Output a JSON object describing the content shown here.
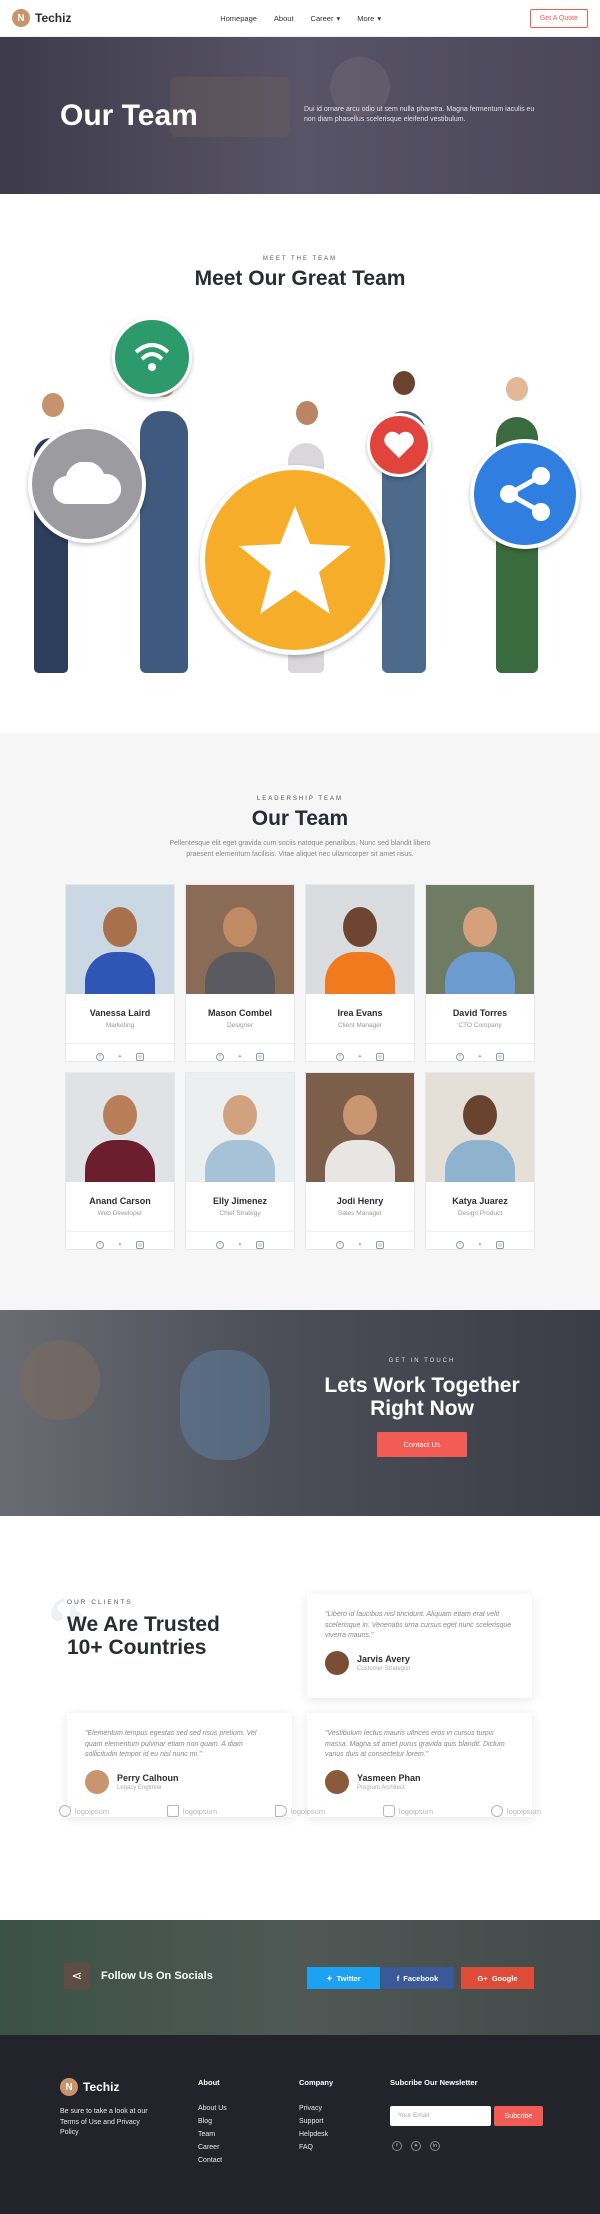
{
  "nav": {
    "brand": "Techiz",
    "logo_letter": "N",
    "menu": [
      "Homepage",
      "About",
      "Career",
      "More"
    ],
    "quote_btn": "Get A Quote"
  },
  "hero": {
    "title": "Our Team",
    "text": "Dui id ornare arcu odio ut sem nulla pharetra. Magna fermentum iaculis eu non diam phasellus scelerisque eleifend vestibulum."
  },
  "meet": {
    "kicker": "MEET THE TEAM",
    "title": "Meet Our Great Team"
  },
  "leadership": {
    "kicker": "LEADERSHIP TEAM",
    "title": "Our Team",
    "desc": "Pellentesque elit eget gravida cum sociis natoque penatibus. Nunc sed blandit libero praesent elementum facilisis. Vitae aliquet nec ullamcorper sit amet risus.",
    "members": [
      {
        "name": "Vanessa Laird",
        "role": "Marketing"
      },
      {
        "name": "Mason Combel",
        "role": "Designer"
      },
      {
        "name": "Irea Evans",
        "role": "Client Manager"
      },
      {
        "name": "David Torres",
        "role": "CTO Company"
      },
      {
        "name": "Anand Carson",
        "role": "Web Developer"
      },
      {
        "name": "Elly Jimenez",
        "role": "Chief Strategy"
      },
      {
        "name": "Jodi Henry",
        "role": "Sales Manager"
      },
      {
        "name": "Katya Juarez",
        "role": "Design Product"
      }
    ]
  },
  "touch": {
    "kicker": "GET IN TOUCH",
    "title_line1": "Lets Work Together",
    "title_line2": "Right Now",
    "button": "Contact Us"
  },
  "clients": {
    "kicker": "OUR CLIENTS",
    "title_line1": "We Are Trusted",
    "title_line2": "10+ Countries",
    "testimonials": [
      {
        "quote": "\"Libero id faucibus nisl tincidunt. Aliquam etiam erat velit scelerisque in. Venenatis urna cursus eget nunc scelerisque viverra mauris.\"",
        "name": "Jarvis Avery",
        "position": "Customer Strategist"
      },
      {
        "quote": "\"Elementum tempus egestas sed sed risus pretium. Vel quam elementum pulvinar etiam non quam. A diam sollicitudin tempor id eu nisl nunc mi.\"",
        "name": "Perry Calhoun",
        "position": "Legacy Engineer"
      },
      {
        "quote": "\"Vestibulum lectus mauris ultrices eros in cursus turpis massa. Magna sit amet purus gravida quis blandit. Dictum varius duis at consectetur lorem.\"",
        "name": "Yasmeen Phan",
        "position": "Program Architect"
      }
    ],
    "logos": [
      "logoipsum",
      "logoipsum",
      "logoipsum",
      "logoipsum",
      "logoipsum"
    ]
  },
  "social": {
    "title": "Follow Us On Socials",
    "twitter": "Twitter",
    "facebook": "Facebook",
    "google": "Google"
  },
  "footer": {
    "brand": "Techiz",
    "about_text": "Be sure to take a look at our Terms of Use and Privacy Policy",
    "about_title": "About",
    "about_links": [
      "About Us",
      "Blog",
      "Team",
      "Career",
      "Contact"
    ],
    "company_title": "Company",
    "company_links": [
      "Privacy",
      "Support",
      "Helpdesk",
      "FAQ"
    ],
    "newsletter_title": "Subcribe Our Newsletter",
    "email_placeholder": "Your Email",
    "subscribe_btn": "Subcribe"
  },
  "colors": {
    "accent": "#f25c54",
    "twitter": "#1da1f2",
    "facebook": "#3b5998",
    "google": "#dd4b39",
    "dark": "#23232b"
  }
}
